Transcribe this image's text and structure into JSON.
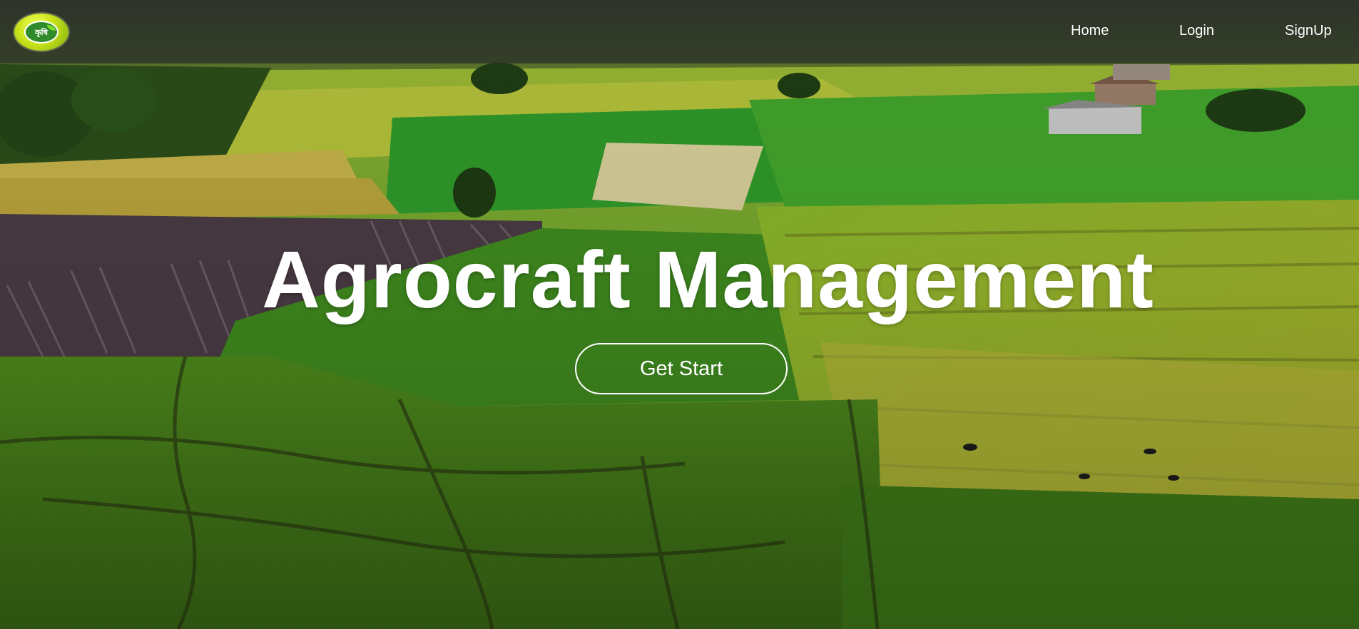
{
  "navbar": {
    "logo_text": "कृषि",
    "links": {
      "home": "Home",
      "login": "Login",
      "signup": "SignUp"
    }
  },
  "hero": {
    "title": "Agrocraft Management",
    "cta_label": "Get Start"
  },
  "colors": {
    "navbar_bg": "#282d28",
    "logo_yellow": "#c7e21a",
    "text": "#ffffff",
    "field_green": "#5a8a1e",
    "field_yellow": "#b5b82a",
    "soil": "#4a3a3a"
  }
}
